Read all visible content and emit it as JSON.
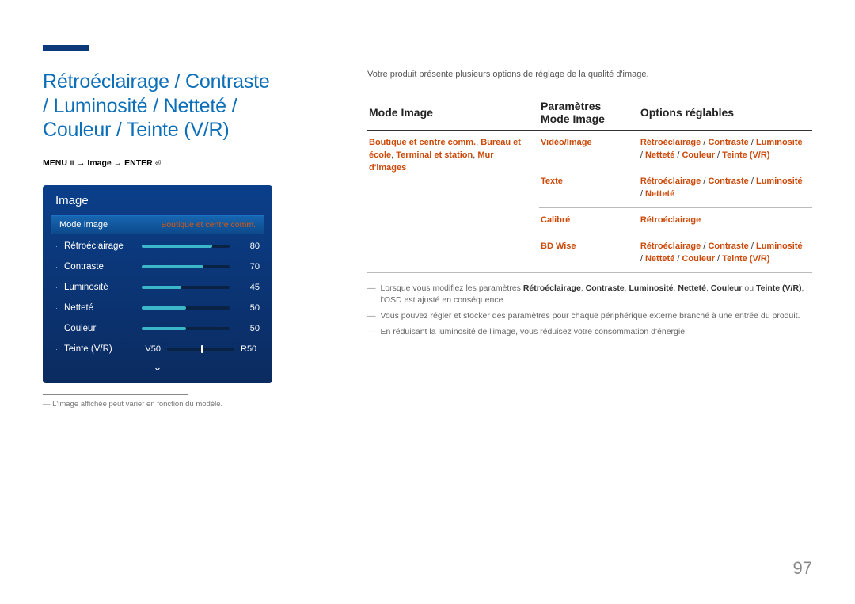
{
  "page_number": "97",
  "heading": "Rétroéclairage / Contraste / Luminosité / Netteté / Couleur / Teinte (V/R)",
  "menu_path": {
    "menu": "MENU",
    "arrow": "→",
    "seg1": "Image",
    "enter": "ENTER"
  },
  "osd": {
    "title": "Image",
    "mode_label": "Mode Image",
    "mode_value": "Boutique et centre comm.",
    "rows": [
      {
        "label": "Rétroéclairage",
        "value": "80",
        "pct": 80
      },
      {
        "label": "Contraste",
        "value": "70",
        "pct": 70
      },
      {
        "label": "Luminosité",
        "value": "45",
        "pct": 45
      },
      {
        "label": "Netteté",
        "value": "50",
        "pct": 50
      },
      {
        "label": "Couleur",
        "value": "50",
        "pct": 50
      }
    ],
    "tint": {
      "label": "Teinte (V/R)",
      "left": "V50",
      "right": "R50",
      "pos": 50
    },
    "note": "L'image affichée peut varier en fonction du modèle."
  },
  "intro": "Votre produit présente plusieurs options de réglage de la qualité d'image.",
  "table": {
    "headers": [
      "Mode Image",
      "Paramètres Mode Image",
      "Options réglables"
    ],
    "rows": [
      {
        "c0": "Boutique et centre comm., Bureau et école, Terminal et station, Mur d'images",
        "c1": "Vidéo/Image",
        "c2": "Rétroéclairage / Contraste / Luminosité / Netteté / Couleur / Teinte (V/R)"
      },
      {
        "c0": "",
        "c1": "Texte",
        "c2": "Rétroéclairage / Contraste / Luminosité / Netteté"
      },
      {
        "c0": "",
        "c1": "Calibré",
        "c2": "Rétroéclairage"
      },
      {
        "c0": "",
        "c1": "BD Wise",
        "c2": "Rétroéclairage / Contraste / Luminosité / Netteté / Couleur / Teinte (V/R)"
      }
    ]
  },
  "notes": {
    "n1_pre": "Lorsque vous modifiez les paramètres ",
    "n1_b1": "Rétroéclairage",
    "n1_s1": ", ",
    "n1_b2": "Contraste",
    "n1_s2": ", ",
    "n1_b3": "Luminosité",
    "n1_s3": ", ",
    "n1_b4": "Netteté",
    "n1_s4": ", ",
    "n1_b5": "Couleur",
    "n1_s5": " ou ",
    "n1_b6": "Teinte (V/R)",
    "n1_post": ", l'OSD est ajusté en conséquence.",
    "n2": "Vous pouvez régler et stocker des paramètres pour chaque périphérique externe branché à une entrée du produit.",
    "n3": "En réduisant la luminosité de l'image, vous réduisez votre consommation d'énergie."
  }
}
